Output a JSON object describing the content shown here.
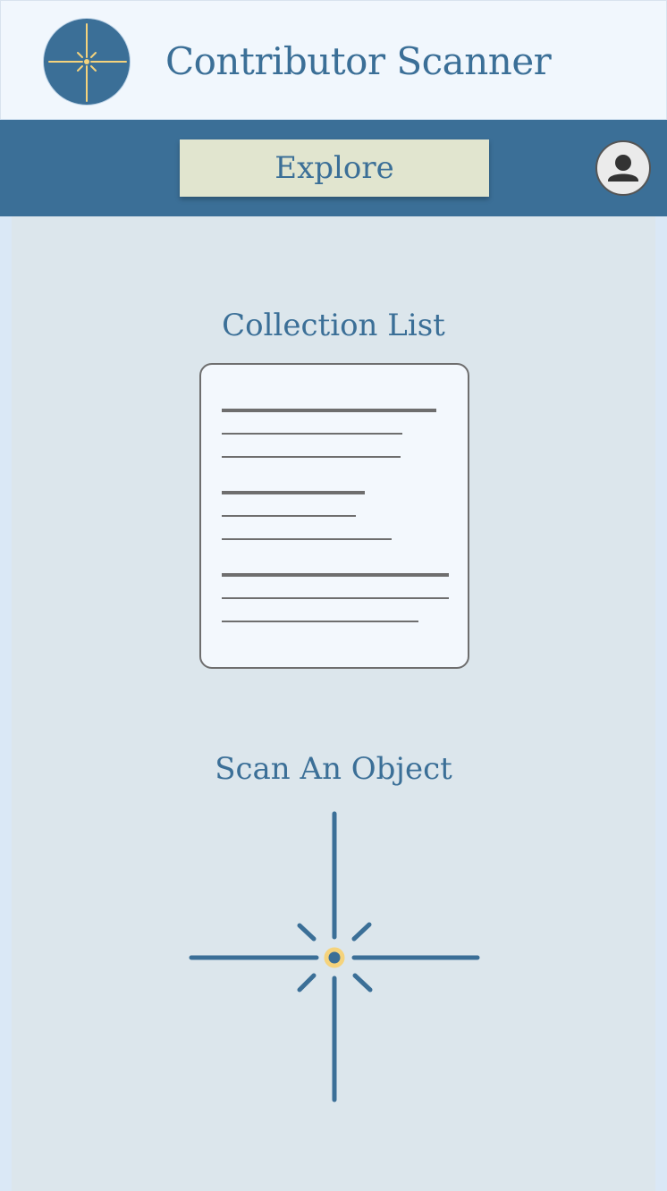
{
  "header": {
    "app_title": "Contributor Scanner",
    "logo_icon": "crosshair-sparkle-icon"
  },
  "navbar": {
    "explore_label": "Explore",
    "profile_icon": "user-icon"
  },
  "main": {
    "collection_title": "Collection List",
    "collection_icon": "document-list-icon",
    "scan_title": "Scan An Object",
    "scan_icon": "crosshair-sparkle-icon"
  },
  "colors": {
    "brand_blue": "#3b6f97",
    "header_bg": "#f1f7fd",
    "button_bg": "#e1e5cf",
    "content_bg": "#dce6ec",
    "accent_yellow": "#f5d37c"
  }
}
